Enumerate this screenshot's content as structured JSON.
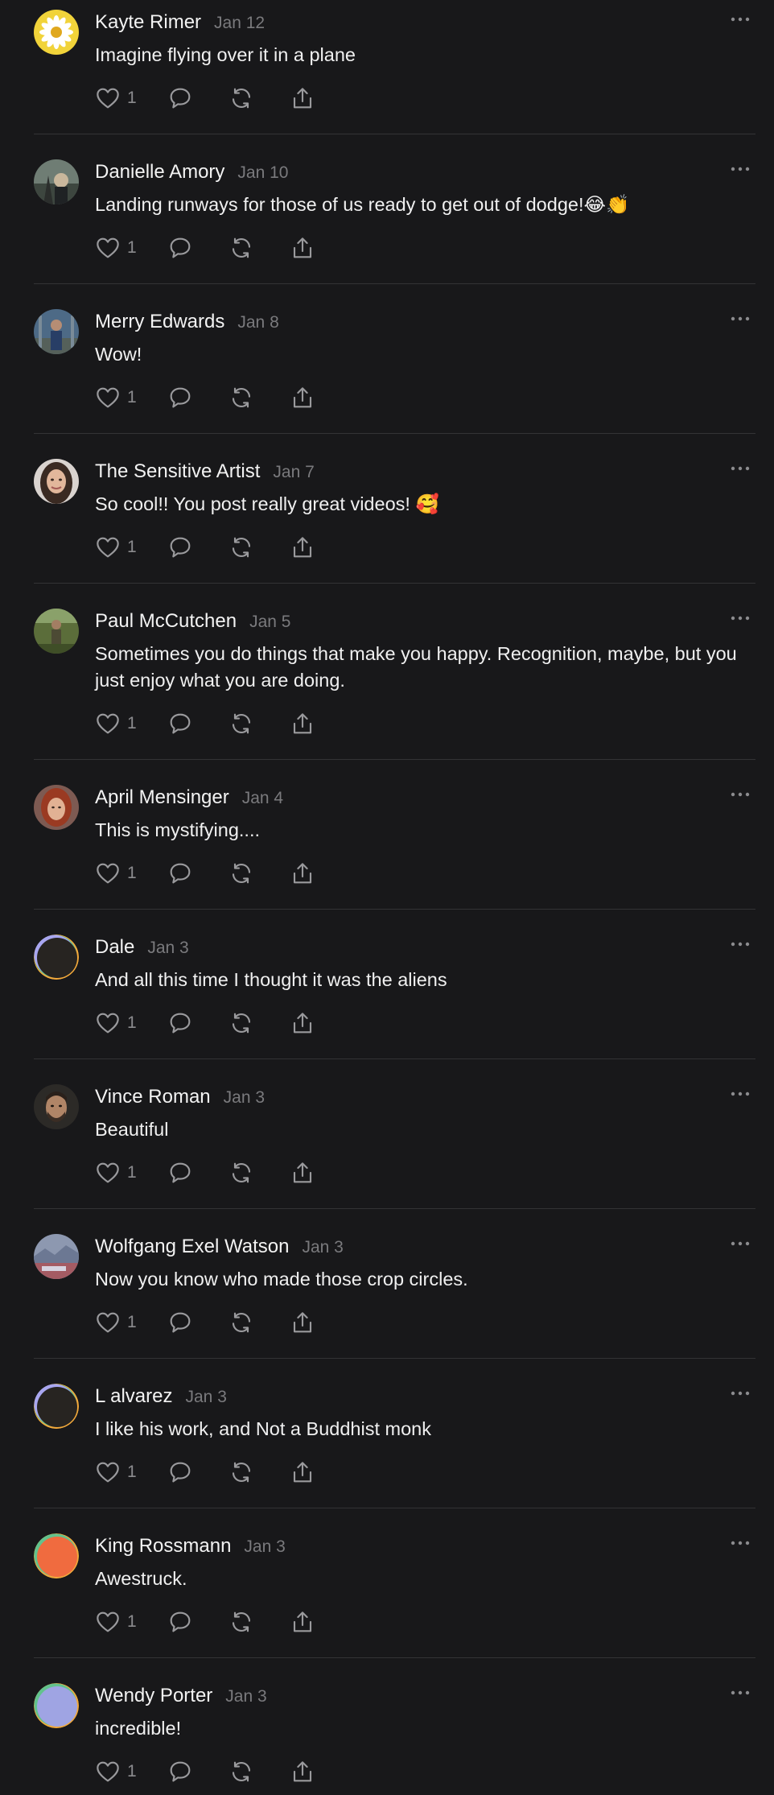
{
  "colors": {
    "background": "#18181a",
    "divider": "#333335",
    "text_primary": "#f2f2f2",
    "text_secondary": "#7a7a7d",
    "icon": "#9a9a9d"
  },
  "icons": {
    "like": "heart-icon",
    "reply": "comment-icon",
    "repost": "repost-icon",
    "share": "share-icon",
    "more": "more-options-icon"
  },
  "posts": [
    {
      "author": "Kayte Rimer",
      "date": "Jan 12",
      "text": "Imagine flying over it in a plane",
      "likes": "1",
      "avatar": "daisy"
    },
    {
      "author": "Danielle Amory",
      "date": "Jan 10",
      "text": "Landing runways for those of us ready to get out of dodge!😂👏",
      "likes": "1",
      "avatar": "photo-tree"
    },
    {
      "author": "Merry Edwards",
      "date": "Jan 8",
      "text": "Wow!",
      "likes": "1",
      "avatar": "photo-person-blue"
    },
    {
      "author": "The Sensitive Artist",
      "date": "Jan 7",
      "text": "So cool!! You post really great videos! 🥰",
      "likes": "1",
      "avatar": "photo-woman"
    },
    {
      "author": "Paul McCutchen",
      "date": "Jan 5",
      "text": "Sometimes you do things that make you happy. Recognition, maybe, but you just enjoy what you are doing.",
      "likes": "1",
      "avatar": "photo-field"
    },
    {
      "author": "April Mensinger",
      "date": "Jan 4",
      "text": "This is mystifying....",
      "likes": "1",
      "avatar": "photo-redhead"
    },
    {
      "author": "Dale",
      "date": "Jan 3",
      "text": "And all this time I thought it was the aliens",
      "likes": "1",
      "avatar": "default-dark"
    },
    {
      "author": "Vince Roman",
      "date": "Jan 3",
      "text": "Beautiful",
      "likes": "1",
      "avatar": "photo-man"
    },
    {
      "author": "Wolfgang Exel Watson",
      "date": "Jan 3",
      "text": "Now you know who made those crop circles.",
      "likes": "1",
      "avatar": "photo-landscape"
    },
    {
      "author": "L alvarez",
      "date": "Jan 3",
      "text": "I like his work, and Not a Buddhist monk",
      "likes": "1",
      "avatar": "default-dark"
    },
    {
      "author": "King Rossmann",
      "date": "Jan 3",
      "text": "Awestruck.",
      "likes": "1",
      "avatar": "default-orange"
    },
    {
      "author": "Wendy Porter",
      "date": "Jan 3",
      "text": "incredible!",
      "likes": "1",
      "avatar": "default-lavender"
    }
  ]
}
